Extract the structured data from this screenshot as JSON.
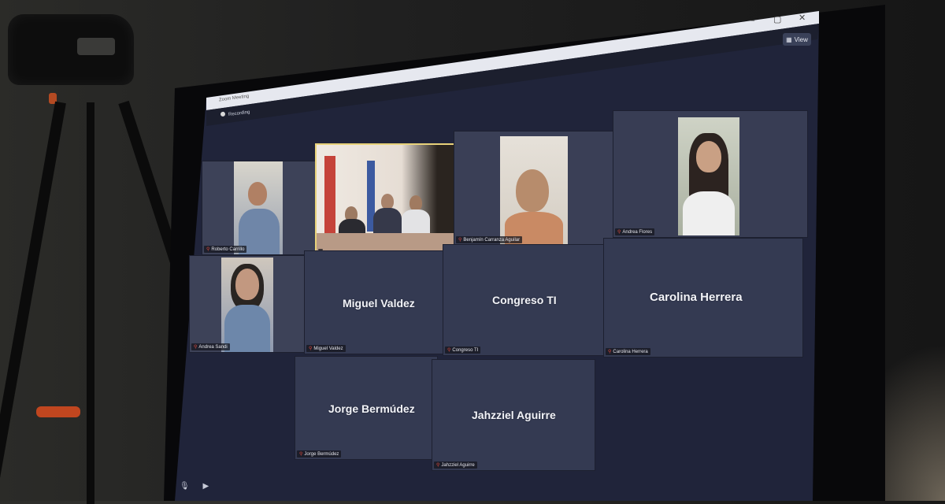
{
  "window": {
    "title": "Zoom Meeting",
    "recording_label": "Recording",
    "view_button": "View"
  },
  "participants": {
    "video": [
      {
        "name": "Roberto Carrillo"
      },
      {
        "name": ""
      },
      {
        "name": "Benjamín Carranza Aguilar"
      },
      {
        "name": "Andrea Flores"
      },
      {
        "name": "Andrea Sandi"
      }
    ],
    "named_tiles": [
      {
        "display": "Miguel Valdez",
        "tag": "Miguel Valdez"
      },
      {
        "display": "Congreso TI",
        "tag": "Congreso TI"
      },
      {
        "display": "Carolina Herrera",
        "tag": "Carolina Herrera"
      },
      {
        "display": "Jorge Bermúdez",
        "tag": "Jorge Bermúdez"
      },
      {
        "display": "Jahzziel Aguirre",
        "tag": "Jahzziel Aguirre"
      }
    ]
  },
  "icons": [
    "microphone-icon",
    "video-camera-icon",
    "view-grid-icon",
    "minimize-icon",
    "maximize-icon",
    "close-icon",
    "mic-muted-icon"
  ],
  "colors": {
    "tile_bg": "#343a52",
    "screen_bg": "#24283a",
    "muted": "#e04a3c",
    "active_speaker_border": "#e8d27a"
  }
}
